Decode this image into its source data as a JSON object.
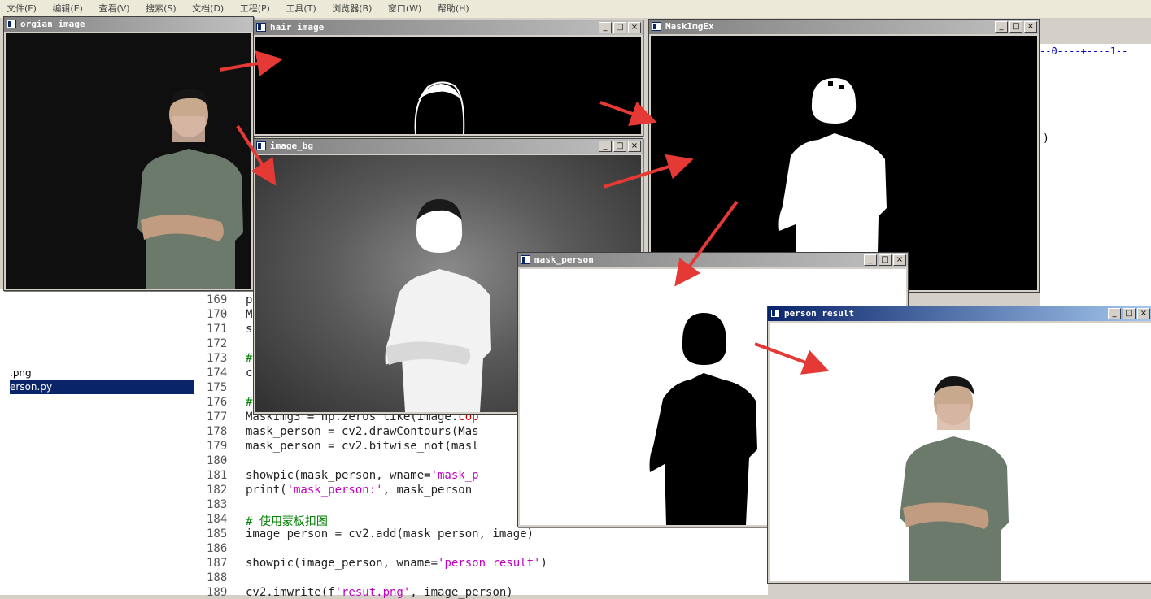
{
  "menubar": {
    "items": [
      "文件(F)",
      "编辑(E)",
      "查看(V)",
      "搜索(S)",
      "文档(D)",
      "工程(P)",
      "工具(T)",
      "浏览器(B)",
      "窗口(W)",
      "帮助(H)"
    ]
  },
  "ruler": {
    "text": "--0----+----1--"
  },
  "editor_tail": {
    "text": ")"
  },
  "file_list": {
    "items": [
      {
        "name": ".png",
        "selected": false
      },
      {
        "name": "erson.py",
        "selected": true
      }
    ]
  },
  "code": {
    "lines": [
      {
        "n": "169",
        "t": "p"
      },
      {
        "n": "170",
        "t": "M"
      },
      {
        "n": "171",
        "t": "s"
      },
      {
        "n": "172",
        "t": ""
      },
      {
        "n": "173",
        "t": "#"
      },
      {
        "n": "174",
        "t": "c"
      },
      {
        "n": "175",
        "t": ""
      },
      {
        "n": "176",
        "t": "#"
      },
      {
        "n": "177",
        "t": "MaskImg3 = np.zeros_like(image.cop"
      },
      {
        "n": "178",
        "t": "mask_person = cv2.drawContours(Mas"
      },
      {
        "n": "179",
        "t": "mask_person = cv2.bitwise_not(masl"
      },
      {
        "n": "180",
        "t": ""
      },
      {
        "n": "181",
        "t": "showpic(mask_person, wname='mask_p"
      },
      {
        "n": "182",
        "t": "print('mask_person:', mask_person"
      },
      {
        "n": "183",
        "t": ""
      },
      {
        "n": "184",
        "t": "# 使用蒙板扣图"
      },
      {
        "n": "185",
        "t": "image_person = cv2.add(mask_person, image)"
      },
      {
        "n": "186",
        "t": ""
      },
      {
        "n": "187",
        "t": "showpic(image_person, wname='person result')"
      },
      {
        "n": "188",
        "t": ""
      },
      {
        "n": "189",
        "t": "cv2.imwrite(f'resut.png', image_person)"
      }
    ]
  },
  "windows": {
    "orgian": {
      "title": "orgian image"
    },
    "hair": {
      "title": "hair image"
    },
    "maskimgex": {
      "title": "MaskImgEx"
    },
    "image_bg": {
      "title": "image_bg"
    },
    "mask_person": {
      "title": "mask_person"
    },
    "person_result": {
      "title": "person result"
    }
  },
  "controls": {
    "minimize": "_",
    "maximize": "□",
    "close": "×"
  },
  "colors": {
    "arrow": "#e53935",
    "titlebar_active": "#0a246a",
    "selection": "#0a246a"
  }
}
